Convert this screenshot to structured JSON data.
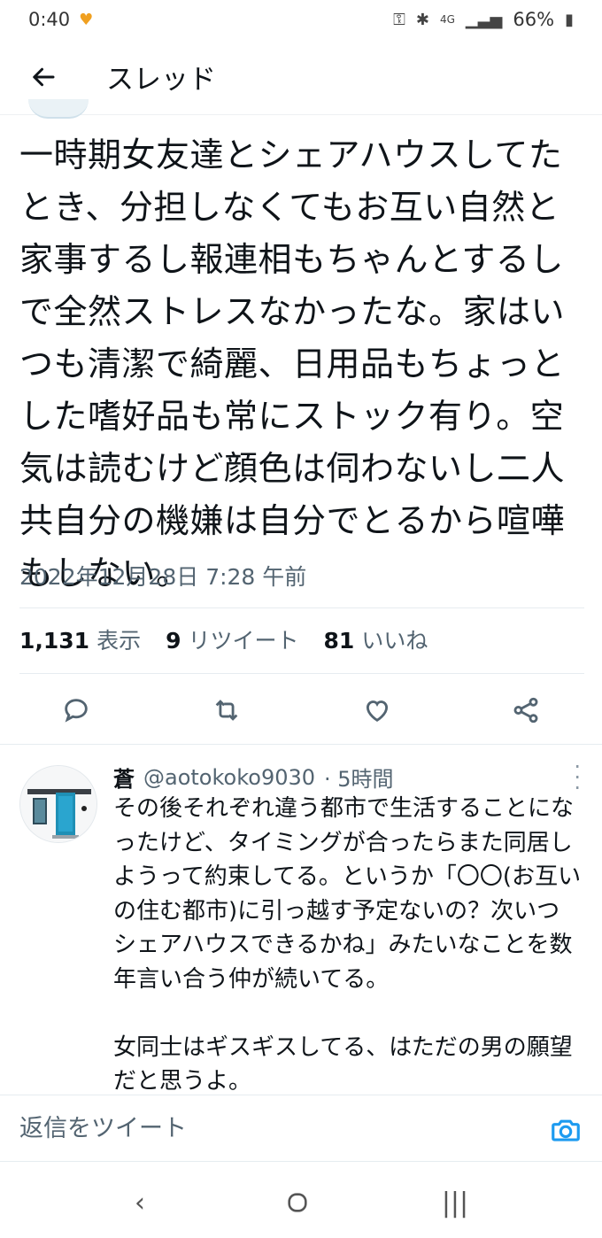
{
  "status_bar": {
    "time": "0:40",
    "network": "4G",
    "battery": "66%",
    "icons": [
      "key-icon",
      "bluetooth-icon",
      "signal-icon",
      "battery-icon",
      "notification-icon"
    ]
  },
  "header": {
    "title": "スレッド",
    "back_icon": "arrow-left-icon"
  },
  "tweet": {
    "text": "一時期女友達とシェアハウスしてたとき、分担しなくてもお互い自然と家事するし報連相もちゃんとするしで全然ストレスなかったな。家はいつも清潔で綺麗、日用品もちょっとした嗜好品も常にストック有り。空気は読むけど顔色は伺わないし二人共自分の機嫌は自分でとるから喧嘩もしない。",
    "timestamp": "2022年12月28日 7:28 午前",
    "stats": {
      "views_count": "1,131",
      "views_label": "表示",
      "retweets_count": "9",
      "retweets_label": "リツイート",
      "likes_count": "81",
      "likes_label": "いいね"
    }
  },
  "actions": [
    "reply-icon",
    "retweet-icon",
    "like-icon",
    "share-icon"
  ],
  "reply": {
    "name": "蒼",
    "handle": "@aotokoko9030",
    "time": "· 5時間",
    "text": "その後それぞれ違う都市で生活することになったけど、タイミングが合ったらまた同居しようって約束してる。というか「〇〇(お互いの住む都市)に引っ越す予定ないの？次いつシェアハウスできるかね」みたいなことを数年言い合う仲が続いてる。\n\n女同士はギスギスしてる、はただの男の願望だと思うよ。"
  },
  "composer": {
    "placeholder": "返信をツイート"
  },
  "colors": {
    "text": "#0f1419",
    "secondary": "#536471",
    "accent": "#1d9bf0",
    "divider": "#e6ecf0"
  }
}
